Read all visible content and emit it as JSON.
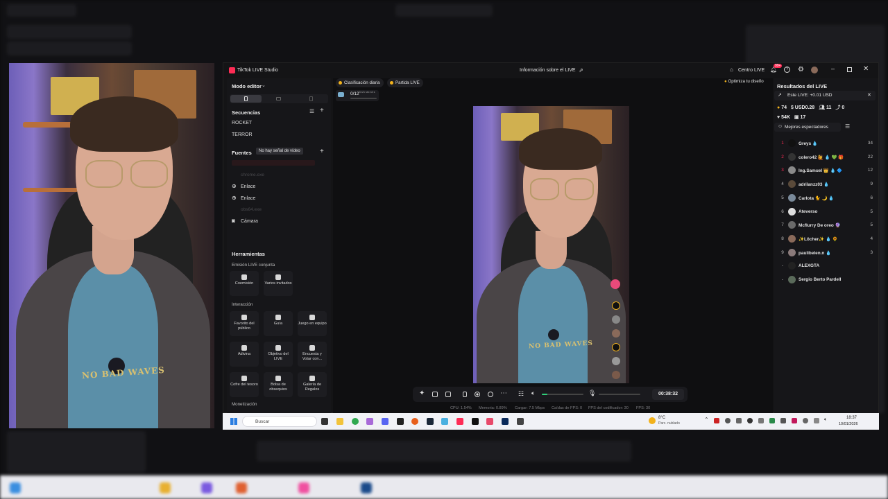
{
  "window": {
    "app_title": "TikTok LIVE Studio",
    "center_title": "Información sobre el LIVE",
    "centro_live": "Centro LIVE",
    "notif_badge": "99+"
  },
  "left": {
    "mode_editor": "Modo editor",
    "sequences_title": "Secuencias",
    "sequences": [
      "ROCKET",
      "TERROR"
    ],
    "sources_title": "Fuentes",
    "no_video_tooltip": "No hay señal de vídeo",
    "sources_dim": [
      "chrome.exe",
      "obs64.exe"
    ],
    "sources": [
      "Enlace",
      "Enlace",
      "Cámara"
    ],
    "tools_title": "Herramientas",
    "joint_live": "Emisión LIVE conjunta",
    "joint_tools": [
      "Coemisión",
      "Varios invitados"
    ],
    "interaction_title": "Interacción",
    "interaction_tools": [
      "Favorito del público",
      "Guía",
      "Juego en equipo",
      "Adivina",
      "Objetivo del LIVE",
      "Encuesta y Votar con...",
      "Cofre del tesoro",
      "Bolsa de obsequios",
      "Galería de Regalos"
    ],
    "monetization_title": "Monetización"
  },
  "center": {
    "chip_daily": "Clasificación diaria",
    "chip_match": "Partida LIVE",
    "progress_text": "0/12",
    "progress_sub": "23:21 sec 44 s",
    "optimize": "Optimiza tu diseño",
    "timer": "00:38:32",
    "shirt_text": "NO BAD WAVES"
  },
  "right": {
    "results_title": "Resultados del LIVE",
    "this_live": "Este LIVE: +0.01 USD",
    "stats_row1": [
      "74",
      "USD0.28",
      "11",
      "0"
    ],
    "stats_row2": [
      "54K",
      "17"
    ],
    "best_viewers": "Mejores espectadores",
    "viewers": [
      {
        "rank": "1",
        "name": "Greys 💧",
        "score": "34",
        "color": "#111111"
      },
      {
        "rank": "2",
        "name": "colero42 🙋 💧 💚 🎁",
        "score": "22",
        "color": "#333333"
      },
      {
        "rank": "3",
        "name": "Ing.Samuel 👑 💧 🔷",
        "score": "12",
        "color": "#8a8a8a"
      },
      {
        "rank": "4",
        "name": "adrilanzz03 💧",
        "score": "9",
        "color": "#5a4a3a"
      },
      {
        "rank": "5",
        "name": "Carlota 🐈 🌙 💧",
        "score": "6",
        "color": "#7a8a9a"
      },
      {
        "rank": "6",
        "name": "Ateverso",
        "score": "5",
        "color": "#dddddd"
      },
      {
        "rank": "7",
        "name": "Mcflurry De oreo 🔮",
        "score": "5",
        "color": "#6a6a6a"
      },
      {
        "rank": "8",
        "name": "✨Löcher✨ 💧 🌻",
        "score": "4",
        "color": "#8a6a5a"
      },
      {
        "rank": "9",
        "name": "paulibelen.n 💧",
        "score": "3",
        "color": "#8a7a7a"
      },
      {
        "rank": "-",
        "name": "ALEXGTA",
        "score": "",
        "color": "#222222"
      },
      {
        "rank": "-",
        "name": "Sergio Berto Pardell",
        "score": "",
        "color": "#5a6a5a"
      }
    ]
  },
  "stats_bar": {
    "cpu": "CPU: 1.54%",
    "memory": "Memoria: 0.89%",
    "load": "Cargar: 7.5 Mbps",
    "fps_loss": "Caídas de FPS: 0",
    "encoder": "FPS del codificador: 30",
    "fps": "FPS: 30"
  },
  "taskbar": {
    "search": "Buscar",
    "weather_temp": "8°C",
    "weather_desc": "Parc. nublado",
    "time": "18:37",
    "date": "10/01/2026"
  },
  "colors": {
    "accent_red": "#fe2c55",
    "gold": "#f2b21c",
    "green": "#2fd07a"
  }
}
